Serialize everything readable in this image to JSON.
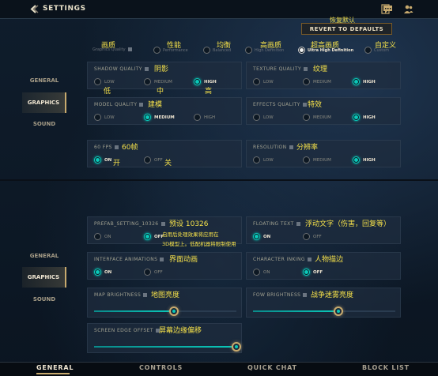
{
  "header": {
    "title": "SETTINGS"
  },
  "top_nav": [
    "GENERAL",
    "GRAPHICS",
    "SOUND"
  ],
  "bottom_nav": [
    "GENERAL",
    "GRAPHICS",
    "SOUND"
  ],
  "revert": {
    "label": "REVERT TO DEFAULTS",
    "cn": "恢复默认"
  },
  "graphics_quality": {
    "label": "Graphics Quality",
    "cn": "画质",
    "options": [
      {
        "label": "Performance",
        "cn": "性能"
      },
      {
        "label": "Balanced",
        "cn": "均衡"
      },
      {
        "label": "High Definition",
        "cn": "高画质"
      },
      {
        "label": "Ultra High Definition",
        "cn": "超高画质"
      },
      {
        "label": "Custom",
        "cn": "自定义"
      }
    ],
    "selected": "Ultra High Definition"
  },
  "shadow_quality": {
    "label": "SHADOW QUALITY",
    "cn": "阴影",
    "options": [
      "LOW",
      "MEDIUM",
      "HIGH"
    ],
    "options_cn": [
      "低",
      "中",
      "高"
    ],
    "selected": "HIGH"
  },
  "texture_quality": {
    "label": "TEXTURE QUALITY",
    "cn": "纹理",
    "options": [
      "LOW",
      "MEDIUM",
      "HIGH"
    ],
    "selected": "HIGH"
  },
  "model_quality": {
    "label": "MODEL QUALITY",
    "cn": "建模",
    "options": [
      "LOW",
      "MEDIUM",
      "HIGH"
    ],
    "selected": "MEDIUM"
  },
  "effects_quality": {
    "label": "EFFECTS QUALITY",
    "cn": "特效",
    "options": [
      "LOW",
      "MEDIUM",
      "HIGH"
    ],
    "selected": "HIGH"
  },
  "fps": {
    "label": "60 FPS",
    "cn": "60帧",
    "options": [
      "ON",
      "OFF"
    ],
    "options_cn": [
      "开",
      "关"
    ],
    "selected": "ON"
  },
  "resolution": {
    "label": "RESOLUTION",
    "cn": "分辨率",
    "options": [
      "LOW",
      "MEDIUM",
      "HIGH"
    ],
    "selected": "HIGH"
  },
  "prefab": {
    "label": "PREFAB_SETTING_10326",
    "cn": "预设 10326",
    "options": [
      "ON",
      "OFF"
    ],
    "selected": "OFF",
    "note_line1": "启用后处理效果将应用在",
    "note_line2": "3D模型上。低配机器将限制使用"
  },
  "floating_text": {
    "label": "FLOATING TEXT",
    "cn": "浮动文字（伤害，回复等）",
    "options": [
      "ON",
      "OFF"
    ],
    "selected": "ON"
  },
  "interface_animations": {
    "label": "INTERFACE ANIMATIONS",
    "cn": "界面动画",
    "options": [
      "ON",
      "OFF"
    ],
    "selected": "ON"
  },
  "character_inking": {
    "label": "CHARACTER INKING",
    "cn": "人物描边",
    "options": [
      "ON",
      "OFF"
    ],
    "selected": "OFF"
  },
  "map_brightness": {
    "label": "MAP BRIGHTNESS",
    "cn": "地图亮度",
    "value": 0.56
  },
  "fow_brightness": {
    "label": "FOW BRIGHTNESS",
    "cn": "战争迷雾亮度",
    "value": 0.6
  },
  "screen_edge_offset": {
    "label": "SCREEN EDGE OFFSET",
    "cn": "屏幕边缘偏移",
    "value": 1.0
  },
  "bottom_tabs": [
    "GENERAL",
    "CONTROLS",
    "QUICK CHAT",
    "BLOCK LIST"
  ],
  "colors": {
    "accent": "#0ac8b9",
    "gold": "#c8aa6e",
    "annotation": "#f4e04a"
  },
  "icons": [
    "back-arrow-icon",
    "mission-icon",
    "chat-icon",
    "friends-icon",
    "info-icon"
  ]
}
